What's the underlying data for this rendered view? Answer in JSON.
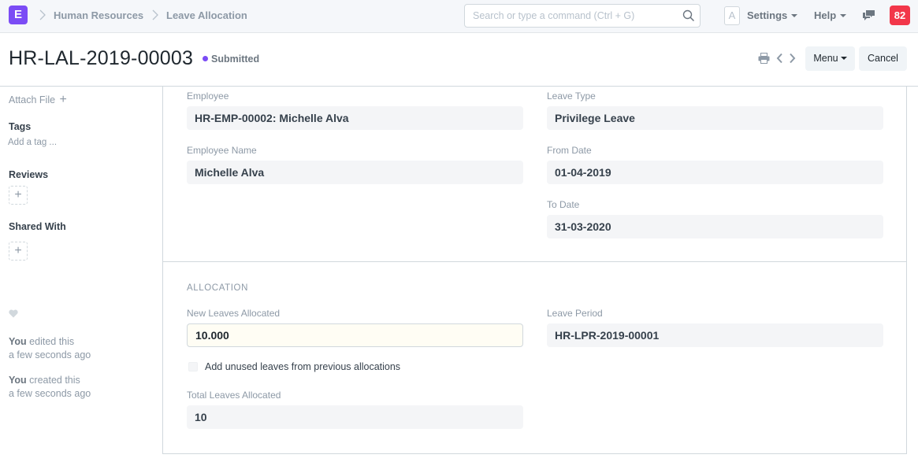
{
  "navbar": {
    "logo_letter": "E",
    "breadcrumbs": [
      "Human Resources",
      "Leave Allocation"
    ],
    "search_placeholder": "Search or type a command (Ctrl + G)",
    "search_value": "",
    "avatar_letter": "A",
    "settings_label": "Settings",
    "help_label": "Help",
    "notification_count": "82"
  },
  "page": {
    "title": "HR-LAL-2019-00003",
    "status": "Submitted",
    "status_color": "#7b4cf5",
    "menu_label": "Menu",
    "cancel_label": "Cancel"
  },
  "sidebar": {
    "attach_file": "Attach File",
    "tags_heading": "Tags",
    "add_tag": "Add a tag ...",
    "reviews_heading": "Reviews",
    "shared_with_heading": "Shared With",
    "timeline": [
      {
        "actor": "You",
        "action": "edited this",
        "time": "a few seconds ago"
      },
      {
        "actor": "You",
        "action": "created this",
        "time": "a few seconds ago"
      }
    ]
  },
  "form": {
    "employee": {
      "label": "Employee",
      "value": "HR-EMP-00002: Michelle Alva"
    },
    "employee_name": {
      "label": "Employee Name",
      "value": "Michelle Alva"
    },
    "leave_type": {
      "label": "Leave Type",
      "value": "Privilege Leave"
    },
    "from_date": {
      "label": "From Date",
      "value": "01-04-2019"
    },
    "to_date": {
      "label": "To Date",
      "value": "31-03-2020"
    },
    "allocation_section": "ALLOCATION",
    "new_leaves_allocated": {
      "label": "New Leaves Allocated",
      "value": "10.000"
    },
    "carry_forward": {
      "label": "Add unused leaves from previous allocations",
      "checked": false
    },
    "total_leaves_allocated": {
      "label": "Total Leaves Allocated",
      "value": "10"
    },
    "leave_period": {
      "label": "Leave Period",
      "value": "HR-LPR-2019-00001"
    }
  }
}
